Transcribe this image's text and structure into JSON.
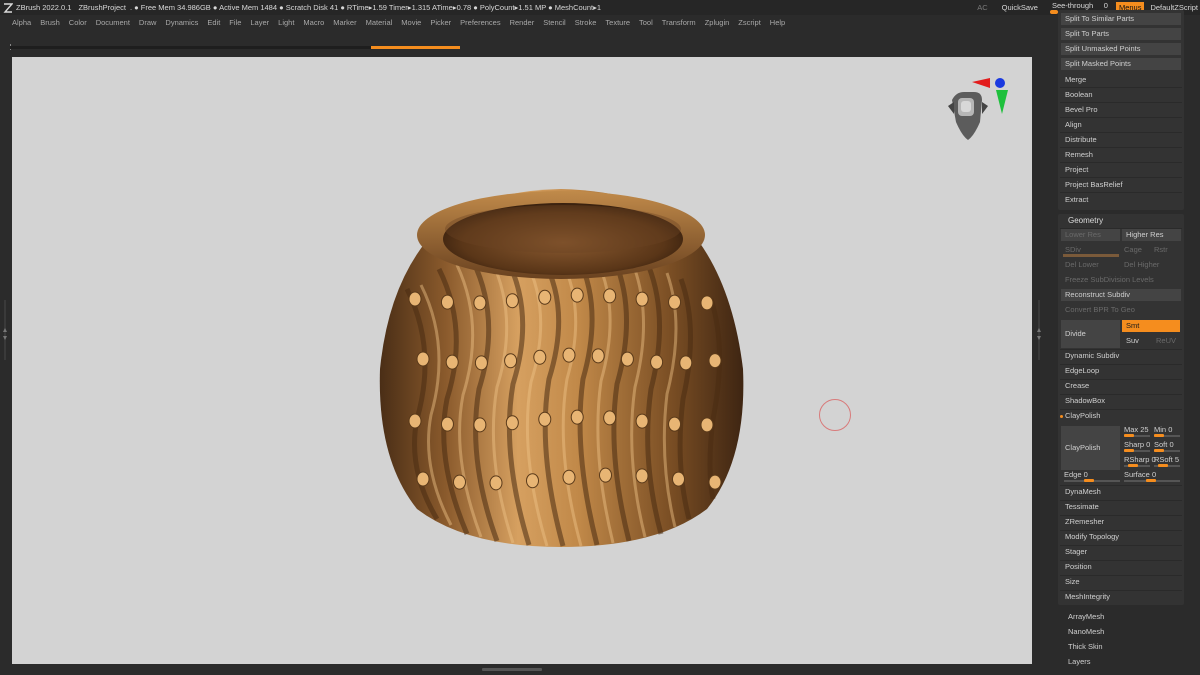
{
  "titlebar": {
    "app": "ZBrush 2022.0.1",
    "project": "ZBrushProject",
    "stats": ". ● Free Mem 34.986GB ● Active Mem 1484 ● Scratch Disk 41 ●  RTime▸1.59 Timer▸1.315 ATime▸0.78 ● PolyCount▸1.51 MP  ● MeshCount▸1",
    "ac": "AC",
    "quicksave": "QuickSave",
    "see_through_label": "See-through",
    "see_through_value": "0",
    "see_through_level": 0,
    "menus": "Menus",
    "default_zscript": "DefaultZScript"
  },
  "menubar": [
    "Alpha",
    "Brush",
    "Color",
    "Document",
    "Draw",
    "Dynamics",
    "Edit",
    "File",
    "Layer",
    "Light",
    "Macro",
    "Marker",
    "Material",
    "Movie",
    "Picker",
    "Preferences",
    "Render",
    "Stencil",
    "Stroke",
    "Texture",
    "Tool",
    "Transform",
    "Zplugin",
    "Zscript",
    "Help"
  ],
  "colors": {
    "accent": "#f58d1e",
    "viewport_bg": "#d3d3d3",
    "panel_bg": "#333333",
    "app_bg": "#2b2b2b",
    "mesh_material": "#b07a40"
  },
  "panel": {
    "subtool_buttons": [
      "Split To Similar Parts",
      "Split To Parts",
      "Split Unmasked Points",
      "Split Masked Points"
    ],
    "subtool_items": [
      "Merge",
      "Boolean",
      "Bevel Pro",
      "Align",
      "Distribute",
      "Remesh",
      "Project",
      "Project BasRelief",
      "Extract"
    ],
    "geometry": {
      "title": "Geometry",
      "lower_res": "Lower Res",
      "higher_res": "Higher Res",
      "sdiv": "SDiv",
      "cage": "Cage",
      "rstr": "Rstr",
      "del_lower": "Del Lower",
      "del_higher": "Del Higher",
      "freeze": "Freeze SubDivision Levels",
      "reconstruct": "Reconstruct Subdiv",
      "convert": "Convert BPR To Geo",
      "divide": "Divide",
      "smt": "Smt",
      "suv": "Suv",
      "reuv": "ReUV",
      "items1": [
        "Dynamic Subdiv",
        "EdgeLoop",
        "Crease",
        "ShadowBox"
      ],
      "claypolish_toggle": "ClayPolish",
      "claypolish_button": "ClayPolish",
      "max_label": "Max",
      "max_value": "25",
      "min_label": "Min",
      "min_value": "0",
      "sharp_label": "Sharp",
      "sharp_value": "0",
      "soft_label": "Soft",
      "soft_value": "0",
      "rsharp_label": "RSharp",
      "rsharp_value": "0",
      "rsoft_label": "RSoft",
      "rsoft_value": "5",
      "edge_label": "Edge",
      "edge_value": "0",
      "surface_label": "Surface",
      "surface_value": "0",
      "items2": [
        "DynaMesh",
        "Tessimate",
        "ZRemesher",
        "Modify Topology",
        "Stager",
        "Position",
        "Size",
        "MeshIntegrity"
      ]
    },
    "bottom_items": [
      "ArrayMesh",
      "NanoMesh",
      "Thick Skin",
      "Layers"
    ]
  }
}
